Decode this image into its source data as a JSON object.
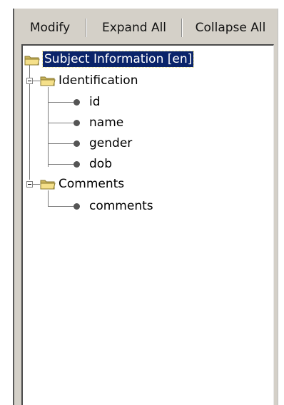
{
  "toolbar": {
    "modify_label": "Modify",
    "expand_all_label": "Expand All",
    "collapse_all_label": "Collapse All"
  },
  "tree": {
    "root": {
      "label": "Subject Information [en]",
      "icon": "folder-open-icon",
      "selected": true
    },
    "groups": [
      {
        "label": "Identification",
        "icon": "folder-open-icon",
        "expanded": true,
        "items": [
          {
            "label": "id",
            "icon": "bullet-icon"
          },
          {
            "label": "name",
            "icon": "bullet-icon"
          },
          {
            "label": "gender",
            "icon": "bullet-icon"
          },
          {
            "label": "dob",
            "icon": "bullet-icon"
          }
        ]
      },
      {
        "label": "Comments",
        "icon": "folder-open-icon",
        "expanded": true,
        "items": [
          {
            "label": "comments",
            "icon": "bullet-icon"
          }
        ]
      }
    ]
  },
  "colors": {
    "panel_bg": "#d4d0c8",
    "selection_bg": "#0a246a",
    "selection_fg": "#ffffff",
    "folder_yellow": "#f5e08a",
    "bullet": "#555555"
  }
}
